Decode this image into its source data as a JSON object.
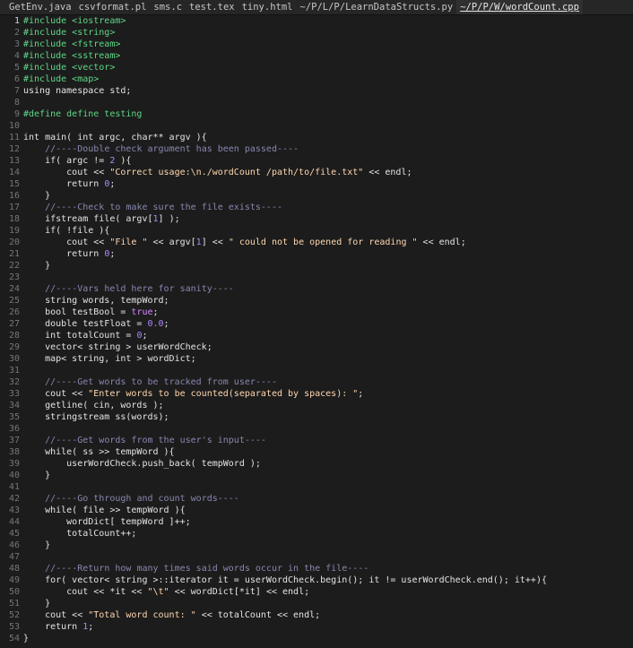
{
  "tabs": [
    {
      "label": "GetEnv.java",
      "active": false
    },
    {
      "label": "csvformat.pl",
      "active": false
    },
    {
      "label": "sms.c",
      "active": false
    },
    {
      "label": "test.tex",
      "active": false
    },
    {
      "label": "tiny.html",
      "active": false
    },
    {
      "label": "~/P/L/P/LearnDataStructs.py",
      "active": false
    },
    {
      "label": "~/P/P/W/wordCount.cpp",
      "active": true
    }
  ],
  "colors": {
    "background": "#1c1c1c",
    "preprocessor": "#5fd787",
    "string": "#ffd7af",
    "number": "#af87ff",
    "comment": "#8787af",
    "line_number": "#767676"
  },
  "lines": [
    {
      "n": "1",
      "tokens": [
        [
          "pp",
          "#include <iostream>"
        ]
      ]
    },
    {
      "n": "2",
      "tokens": [
        [
          "pp",
          "#include <string>"
        ]
      ]
    },
    {
      "n": "3",
      "tokens": [
        [
          "pp",
          "#include <fstream>"
        ]
      ]
    },
    {
      "n": "4",
      "tokens": [
        [
          "pp",
          "#include <sstream>"
        ]
      ]
    },
    {
      "n": "5",
      "tokens": [
        [
          "pp",
          "#include <vector>"
        ]
      ]
    },
    {
      "n": "6",
      "tokens": [
        [
          "pp",
          "#include <map>"
        ]
      ]
    },
    {
      "n": "7",
      "tokens": [
        [
          "plain",
          "using namespace std;"
        ]
      ]
    },
    {
      "n": "8",
      "tokens": []
    },
    {
      "n": "9",
      "tokens": [
        [
          "pp",
          "#define define testing"
        ]
      ]
    },
    {
      "n": "10",
      "tokens": []
    },
    {
      "n": "11",
      "tokens": [
        [
          "plain",
          "int main( int argc, char** argv ){"
        ]
      ]
    },
    {
      "n": "12",
      "tokens": [
        [
          "plain",
          "    "
        ],
        [
          "cmt",
          "//----Double check argument has been passed----"
        ]
      ]
    },
    {
      "n": "13",
      "tokens": [
        [
          "plain",
          "    if( argc != "
        ],
        [
          "num",
          "2"
        ],
        [
          "plain",
          " ){"
        ]
      ]
    },
    {
      "n": "14",
      "tokens": [
        [
          "plain",
          "        cout << "
        ],
        [
          "str",
          "\"Correct usage:\\n./wordCount /path/to/file.txt\""
        ],
        [
          "plain",
          " << endl;"
        ]
      ]
    },
    {
      "n": "15",
      "tokens": [
        [
          "plain",
          "        return "
        ],
        [
          "num",
          "0"
        ],
        [
          "plain",
          ";"
        ]
      ]
    },
    {
      "n": "16",
      "tokens": [
        [
          "plain",
          "    }"
        ]
      ]
    },
    {
      "n": "17",
      "tokens": [
        [
          "plain",
          "    "
        ],
        [
          "cmt",
          "//----Check to make sure the file exists----"
        ]
      ]
    },
    {
      "n": "18",
      "tokens": [
        [
          "plain",
          "    ifstream file( argv["
        ],
        [
          "num",
          "1"
        ],
        [
          "plain",
          "] );"
        ]
      ]
    },
    {
      "n": "19",
      "tokens": [
        [
          "plain",
          "    if( !file ){"
        ]
      ]
    },
    {
      "n": "20",
      "tokens": [
        [
          "plain",
          "        cout << "
        ],
        [
          "str",
          "\"File \""
        ],
        [
          "plain",
          " << argv["
        ],
        [
          "num",
          "1"
        ],
        [
          "plain",
          "] << "
        ],
        [
          "str",
          "\" could not be opened for reading \""
        ],
        [
          "plain",
          " << endl;"
        ]
      ]
    },
    {
      "n": "21",
      "tokens": [
        [
          "plain",
          "        return "
        ],
        [
          "num",
          "0"
        ],
        [
          "plain",
          ";"
        ]
      ]
    },
    {
      "n": "22",
      "tokens": [
        [
          "plain",
          "    }"
        ]
      ]
    },
    {
      "n": "23",
      "tokens": []
    },
    {
      "n": "24",
      "tokens": [
        [
          "plain",
          "    "
        ],
        [
          "cmt",
          "//----Vars held here for sanity----"
        ]
      ]
    },
    {
      "n": "25",
      "tokens": [
        [
          "plain",
          "    string words, tempWord;"
        ]
      ]
    },
    {
      "n": "26",
      "tokens": [
        [
          "plain",
          "    bool testBool = "
        ],
        [
          "bool",
          "true"
        ],
        [
          "plain",
          ";"
        ]
      ]
    },
    {
      "n": "27",
      "tokens": [
        [
          "plain",
          "    double testFloat = "
        ],
        [
          "num",
          "0.0"
        ],
        [
          "plain",
          ";"
        ]
      ]
    },
    {
      "n": "28",
      "tokens": [
        [
          "plain",
          "    int totalCount = "
        ],
        [
          "num",
          "0"
        ],
        [
          "plain",
          ";"
        ]
      ]
    },
    {
      "n": "29",
      "tokens": [
        [
          "plain",
          "    vector< string > userWordCheck;"
        ]
      ]
    },
    {
      "n": "30",
      "tokens": [
        [
          "plain",
          "    map< string, int > wordDict;"
        ]
      ]
    },
    {
      "n": "31",
      "tokens": []
    },
    {
      "n": "32",
      "tokens": [
        [
          "plain",
          "    "
        ],
        [
          "cmt",
          "//----Get words to be tracked from user----"
        ]
      ]
    },
    {
      "n": "33",
      "tokens": [
        [
          "plain",
          "    cout << "
        ],
        [
          "str",
          "\"Enter words to be counted(separated by spaces): \""
        ],
        [
          "plain",
          ";"
        ]
      ]
    },
    {
      "n": "34",
      "tokens": [
        [
          "plain",
          "    getline( cin, words );"
        ]
      ]
    },
    {
      "n": "35",
      "tokens": [
        [
          "plain",
          "    stringstream ss(words);"
        ]
      ]
    },
    {
      "n": "36",
      "tokens": []
    },
    {
      "n": "37",
      "tokens": [
        [
          "plain",
          "    "
        ],
        [
          "cmt",
          "//----Get words from the user's input----"
        ]
      ]
    },
    {
      "n": "38",
      "tokens": [
        [
          "plain",
          "    while( ss >> tempWord ){"
        ]
      ]
    },
    {
      "n": "39",
      "tokens": [
        [
          "plain",
          "        userWordCheck.push_back( tempWord );"
        ]
      ]
    },
    {
      "n": "40",
      "tokens": [
        [
          "plain",
          "    }"
        ]
      ]
    },
    {
      "n": "41",
      "tokens": []
    },
    {
      "n": "42",
      "tokens": [
        [
          "plain",
          "    "
        ],
        [
          "cmt",
          "//----Go through and count words----"
        ]
      ]
    },
    {
      "n": "43",
      "tokens": [
        [
          "plain",
          "    while( file >> tempWord ){"
        ]
      ]
    },
    {
      "n": "44",
      "tokens": [
        [
          "plain",
          "        wordDict[ tempWord ]++;"
        ]
      ]
    },
    {
      "n": "45",
      "tokens": [
        [
          "plain",
          "        totalCount++;"
        ]
      ]
    },
    {
      "n": "46",
      "tokens": [
        [
          "plain",
          "    }"
        ]
      ]
    },
    {
      "n": "47",
      "tokens": []
    },
    {
      "n": "48",
      "tokens": [
        [
          "plain",
          "    "
        ],
        [
          "cmt",
          "//----Return how many times said words occur in the file----"
        ]
      ]
    },
    {
      "n": "49",
      "tokens": [
        [
          "plain",
          "    for( vector< string >::iterator it = userWordCheck.begin(); it != userWordCheck.end(); it++){"
        ]
      ]
    },
    {
      "n": "50",
      "tokens": [
        [
          "plain",
          "        cout << *it << "
        ],
        [
          "str",
          "\"\\t\""
        ],
        [
          "plain",
          " << wordDict[*it] << endl;"
        ]
      ]
    },
    {
      "n": "51",
      "tokens": [
        [
          "plain",
          "    }"
        ]
      ]
    },
    {
      "n": "52",
      "tokens": [
        [
          "plain",
          "    cout << "
        ],
        [
          "str",
          "\"Total word count: \""
        ],
        [
          "plain",
          " << totalCount << endl;"
        ]
      ]
    },
    {
      "n": "53",
      "tokens": [
        [
          "plain",
          "    return "
        ],
        [
          "num",
          "1"
        ],
        [
          "plain",
          ";"
        ]
      ]
    },
    {
      "n": "54",
      "tokens": [
        [
          "plain",
          "}"
        ]
      ]
    }
  ]
}
